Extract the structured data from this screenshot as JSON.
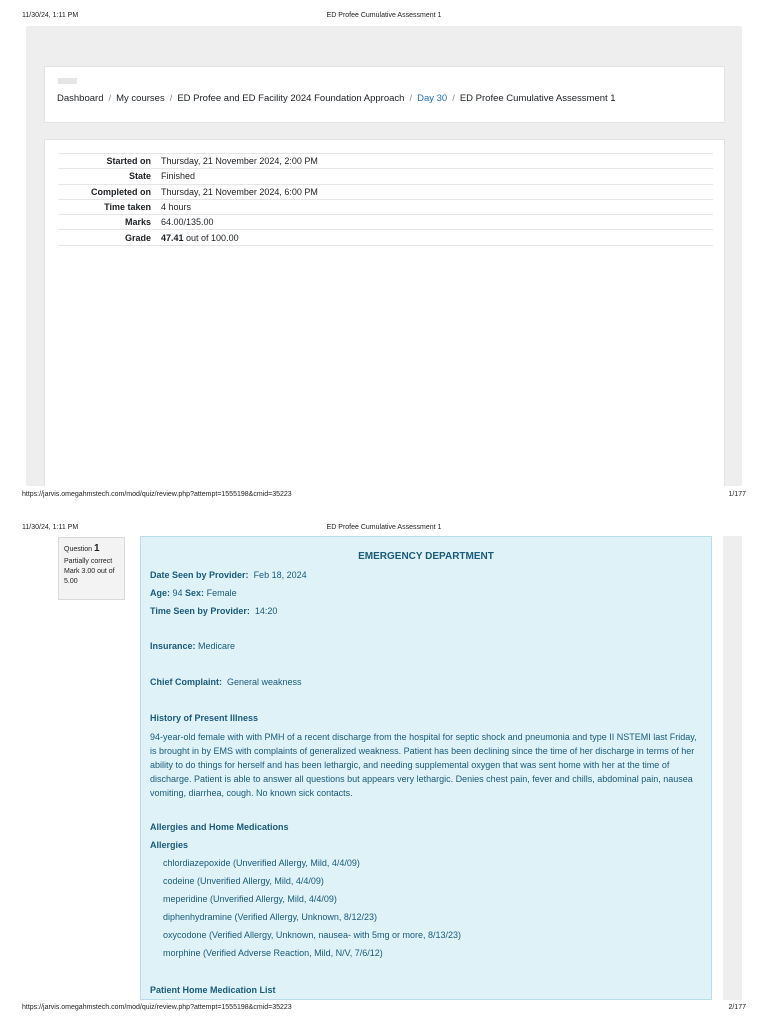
{
  "page1": {
    "print_header": {
      "datetime": "11/30/24, 1:11 PM",
      "title": "ED Profee Cumulative Assessment 1"
    },
    "breadcrumb": [
      {
        "label": "Dashboard",
        "link": false
      },
      {
        "label": "My courses",
        "link": false
      },
      {
        "label": "ED Profee and ED Facility 2024 Foundation Approach",
        "link": false
      },
      {
        "label": "Day 30",
        "link": true
      },
      {
        "label": "ED Profee Cumulative Assessment 1",
        "link": false
      }
    ],
    "summary": {
      "started_on": {
        "label": "Started on",
        "value": "Thursday, 21 November 2024, 2:00 PM"
      },
      "state": {
        "label": "State",
        "value": "Finished"
      },
      "completed_on": {
        "label": "Completed on",
        "value": "Thursday, 21 November 2024, 6:00 PM"
      },
      "time_taken": {
        "label": "Time taken",
        "value": "4 hours"
      },
      "marks": {
        "label": "Marks",
        "value": "64.00/135.00"
      },
      "grade": {
        "label": "Grade",
        "value_bold": "47.41",
        "value_rest": " out of 100.00"
      }
    },
    "print_footer": {
      "url": "https://jarvis.omegahmstech.com/mod/quiz/review.php?attempt=1555198&cmid=35223",
      "page": "1/177"
    }
  },
  "page2": {
    "print_header": {
      "datetime": "11/30/24, 1:11 PM",
      "title": "ED Profee Cumulative Assessment 1"
    },
    "question_info": {
      "question_label": "Question",
      "number": "1",
      "status": "Partially correct",
      "mark": "Mark 3.00 out of 5.00"
    },
    "content": {
      "title": "EMERGENCY DEPARTMENT",
      "date_seen_label": "Date Seen by Provider:",
      "date_seen_value": "Feb 18, 2024",
      "age_label": "Age:",
      "age_value": "94",
      "sex_label": "Sex:",
      "sex_value": "Female",
      "time_seen_label": "Time Seen by Provider:",
      "time_seen_value": "14:20",
      "insurance_label": "Insurance:",
      "insurance_value": "Medicare",
      "chief_complaint_label": "Chief Complaint:",
      "chief_complaint_value": "General weakness",
      "hpi_heading": "History of Present Illness",
      "hpi_text": "94-year-old female with with PMH of a recent discharge from the hospital for septic shock and pneumonia and type II NSTEMI last Friday, is brought in by EMS with complaints of generalized weakness.  Patient has been declining since the time of her discharge in terms of her ability to do things for herself and has been lethargic, and needing supplemental oxygen that was sent home with her at the time of discharge.  Patient is able to answer all questions but appears very lethargic.  Denies chest pain, fever and chills, abdominal pain, nausea vomiting, diarrhea, cough.  No known sick contacts.",
      "allergies_meds_heading": "Allergies and Home Medications",
      "allergies_heading": "Allergies",
      "allergies": [
        "chlordiazepoxide (Unverified  Allergy, Mild, 4/4/09)",
        "codeine (Unverified  Allergy, Mild, 4/4/09)",
        "meperidine (Unverified  Allergy, Mild, 4/4/09)",
        "diphenhydramine (Verified  Allergy, Unknown, 8/12/23)",
        "oxycodone (Verified  Allergy, Unknown, nausea- with 5mg or more, 8/13/23)",
        "morphine (Verified  Adverse Reaction, Mild, N/V, 7/6/12)"
      ],
      "home_meds_heading": "Patient Home Medication List"
    },
    "print_footer": {
      "url": "https://jarvis.omegahmstech.com/mod/quiz/review.php?attempt=1555198&cmid=35223",
      "page": "2/177"
    }
  }
}
